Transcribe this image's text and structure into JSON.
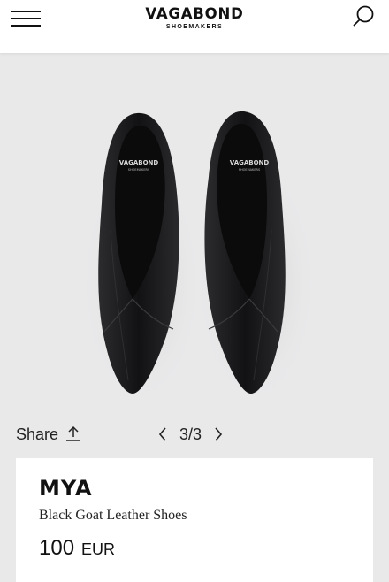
{
  "header": {
    "brand_name": "VAGABOND",
    "brand_sub": "SHOEMAKERS",
    "menu_icon": "hamburger-menu-icon",
    "search_icon": "search-icon"
  },
  "product_image": {
    "insole_brand": "VAGABOND",
    "insole_sub": "SHOEMAKERS",
    "shoe_color": "#18181a",
    "background": "#e9e9ea"
  },
  "controls": {
    "share_label": "Share",
    "share_icon": "share-upload-icon",
    "page_indicator": "3/3",
    "prev_icon": "chevron-left-icon",
    "next_icon": "chevron-right-icon"
  },
  "product": {
    "name": "MYA",
    "description": "Black Goat Leather Shoes",
    "price": "100",
    "currency": "EUR"
  }
}
